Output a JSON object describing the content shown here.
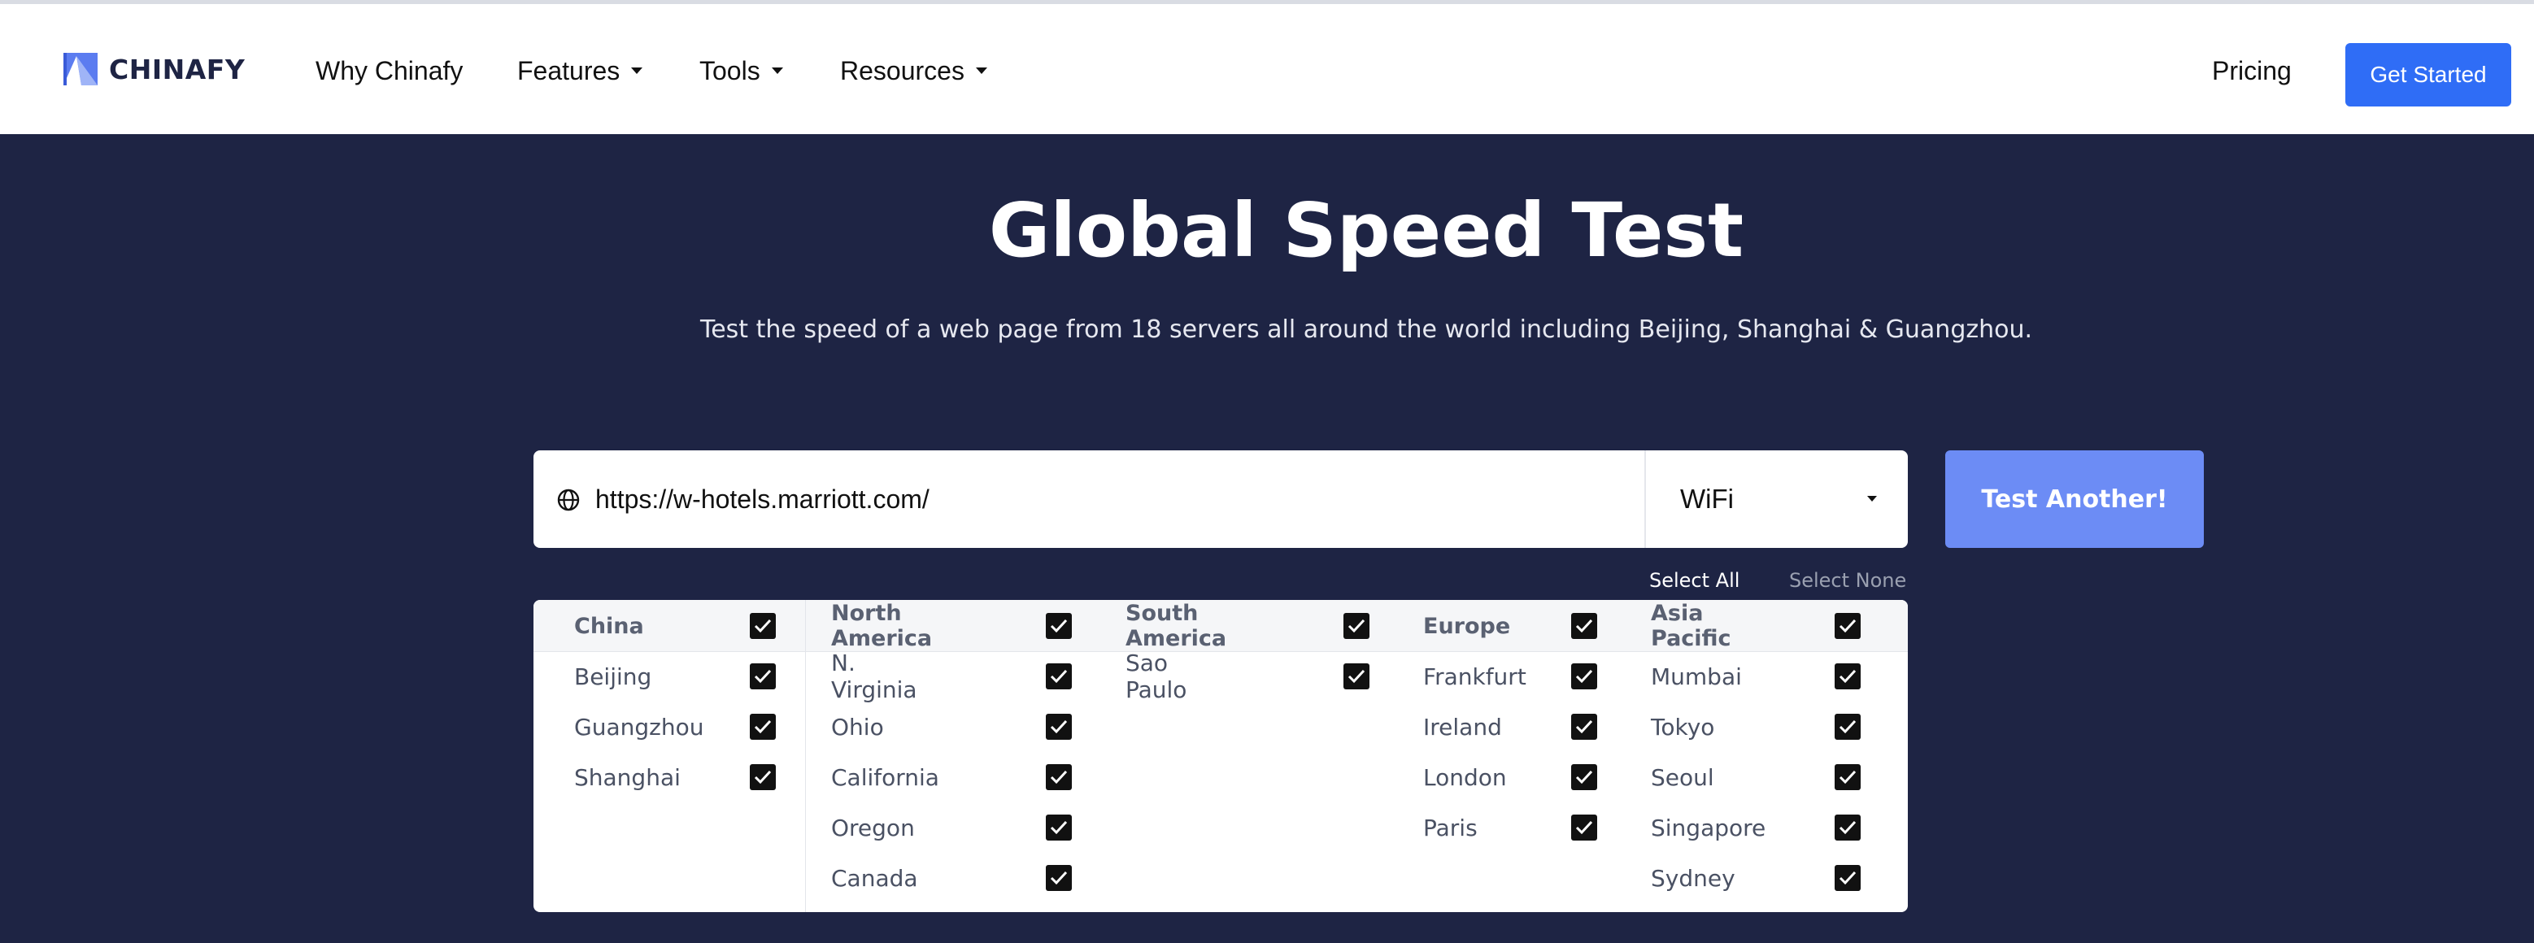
{
  "brand": {
    "name": "CHINAFY",
    "accent": "#2f6df6",
    "nav_bg": "#ffffff",
    "hero_bg": "#1e2444"
  },
  "nav": {
    "items": [
      {
        "label": "Why Chinafy",
        "dropdown": false
      },
      {
        "label": "Features",
        "dropdown": true
      },
      {
        "label": "Tools",
        "dropdown": true
      },
      {
        "label": "Resources",
        "dropdown": true
      }
    ],
    "pricing": "Pricing",
    "cta": "Get Started"
  },
  "hero": {
    "title": "Global Speed Test",
    "subtitle": "Test the speed of a web page from 18 servers all around the world including Beijing, Shanghai & Guangzhou."
  },
  "test_form": {
    "url_value": "https://w-hotels.marriott.com/",
    "network_selected": "WiFi",
    "submit_label": "Test Another!",
    "select_all": "Select All",
    "select_none": "Select None"
  },
  "regions": [
    {
      "name": "China",
      "checked": true,
      "cities": [
        {
          "name": "Beijing",
          "checked": true
        },
        {
          "name": "Guangzhou",
          "checked": true
        },
        {
          "name": "Shanghai",
          "checked": true
        }
      ]
    },
    {
      "name": "North America",
      "checked": true,
      "cities": [
        {
          "name": "N. Virginia",
          "checked": true
        },
        {
          "name": "Ohio",
          "checked": true
        },
        {
          "name": "California",
          "checked": true
        },
        {
          "name": "Oregon",
          "checked": true
        },
        {
          "name": "Canada",
          "checked": true
        }
      ]
    },
    {
      "name": "South America",
      "checked": true,
      "cities": [
        {
          "name": "Sao Paulo",
          "checked": true
        }
      ]
    },
    {
      "name": "Europe",
      "checked": true,
      "cities": [
        {
          "name": "Frankfurt",
          "checked": true
        },
        {
          "name": "Ireland",
          "checked": true
        },
        {
          "name": "London",
          "checked": true
        },
        {
          "name": "Paris",
          "checked": true
        }
      ]
    },
    {
      "name": "Asia Pacific",
      "checked": true,
      "cities": [
        {
          "name": "Mumbai",
          "checked": true
        },
        {
          "name": "Tokyo",
          "checked": true
        },
        {
          "name": "Seoul",
          "checked": true
        },
        {
          "name": "Singapore",
          "checked": true
        },
        {
          "name": "Sydney",
          "checked": true
        }
      ]
    }
  ]
}
